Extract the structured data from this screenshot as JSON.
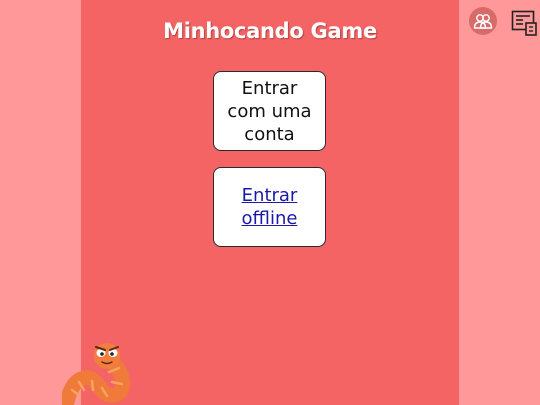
{
  "app": {
    "title": "Minhocando Game"
  },
  "menu": {
    "login_label": "Entrar com uma conta",
    "offline_label": "Entrar offline"
  },
  "toolbar": {
    "ranking_icon": "people-icon",
    "news_icon": "news-icon"
  },
  "colors": {
    "background": "#ff9999",
    "panel": "#f46464",
    "button": "#ffffff",
    "link": "#1a1aa6"
  },
  "mascot": "worm-mascot"
}
